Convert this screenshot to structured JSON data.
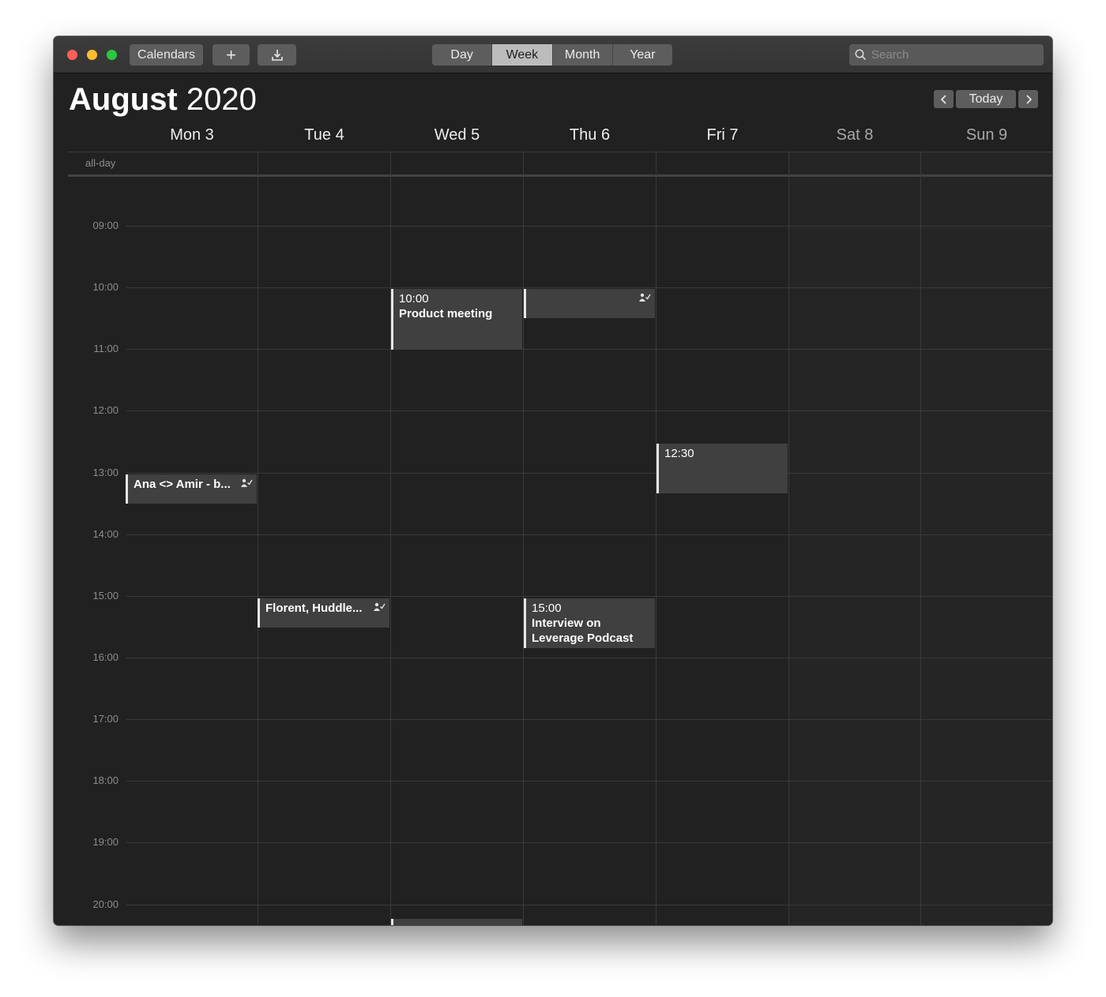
{
  "toolbar": {
    "calendars_label": "Calendars",
    "add_label": "+",
    "import_icon": "download-icon",
    "views": [
      "Day",
      "Week",
      "Month",
      "Year"
    ],
    "active_view": "Week",
    "search_placeholder": "Search"
  },
  "header": {
    "month": "August",
    "year": "2020",
    "today_label": "Today",
    "prev_icon": "chevron-left-icon",
    "next_icon": "chevron-right-icon"
  },
  "days": [
    {
      "label": "Mon 3",
      "weekend": false
    },
    {
      "label": "Tue 4",
      "weekend": false
    },
    {
      "label": "Wed 5",
      "weekend": false
    },
    {
      "label": "Thu 6",
      "weekend": false
    },
    {
      "label": "Fri 7",
      "weekend": false
    },
    {
      "label": "Sat 8",
      "weekend": true
    },
    {
      "label": "Sun 9",
      "weekend": true
    }
  ],
  "allday_label": "all-day",
  "hours": [
    "09:00",
    "10:00",
    "11:00",
    "12:00",
    "13:00",
    "14:00",
    "15:00",
    "16:00",
    "17:00",
    "18:00",
    "19:00",
    "20:00"
  ],
  "events": {
    "product_meeting": {
      "time": "10:00",
      "title": "Product meeting"
    },
    "thu_morning": {
      "time": "",
      "title": ""
    },
    "fri_1230": {
      "time": "12:30",
      "title": ""
    },
    "ana_amir": {
      "time": "",
      "title": "Ana <> Amir - b..."
    },
    "florent": {
      "time": "",
      "title": "Florent, Huddle..."
    },
    "interview": {
      "time": "15:00",
      "title": "Interview on Leverage Podcast"
    }
  },
  "colors": {
    "window_bg": "#222122",
    "event_bg": "#404040",
    "event_bar": "#e6e6e6",
    "grid_line": "#3b3a3b"
  }
}
